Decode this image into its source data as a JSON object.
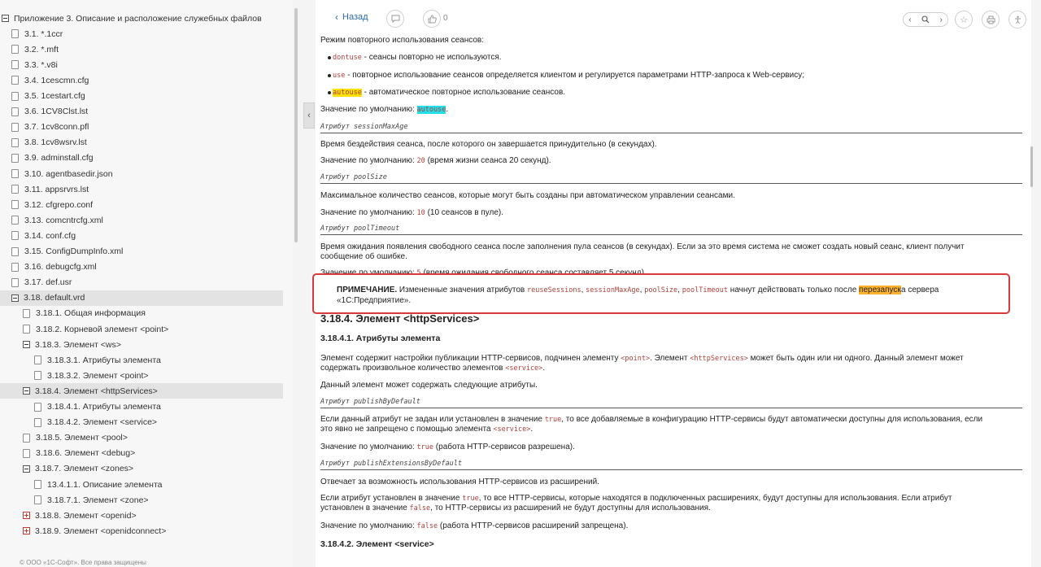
{
  "sidebar": {
    "items": [
      {
        "label": "Приложение 3. Описание и расположение служебных файлов",
        "icon": "toggle-minus",
        "indent": 0,
        "selected": false
      },
      {
        "label": "3.1. *.1ccr",
        "icon": "file",
        "indent": 1
      },
      {
        "label": "3.2. *.mft",
        "icon": "file",
        "indent": 1
      },
      {
        "label": "3.3. *.v8i",
        "icon": "file",
        "indent": 1
      },
      {
        "label": "3.4. 1cescmn.cfg",
        "icon": "file",
        "indent": 1
      },
      {
        "label": "3.5. 1cestart.cfg",
        "icon": "file",
        "indent": 1
      },
      {
        "label": "3.6. 1CV8Clst.lst",
        "icon": "file",
        "indent": 1
      },
      {
        "label": "3.7. 1cv8conn.pfl",
        "icon": "file",
        "indent": 1
      },
      {
        "label": "3.8. 1cv8wsrv.lst",
        "icon": "file",
        "indent": 1
      },
      {
        "label": "3.9. adminstall.cfg",
        "icon": "file",
        "indent": 1
      },
      {
        "label": "3.10. agentbasedir.json",
        "icon": "file",
        "indent": 1
      },
      {
        "label": "3.11. appsrvrs.lst",
        "icon": "file",
        "indent": 1
      },
      {
        "label": "3.12. cfgrepo.conf",
        "icon": "file",
        "indent": 1
      },
      {
        "label": "3.13. comcntrcfg.xml",
        "icon": "file",
        "indent": 1
      },
      {
        "label": "3.14. conf.cfg",
        "icon": "file",
        "indent": 1
      },
      {
        "label": "3.15. ConfigDumpInfo.xml",
        "icon": "file",
        "indent": 1
      },
      {
        "label": "3.16. debugcfg.xml",
        "icon": "file",
        "indent": 1
      },
      {
        "label": "3.17. def.usr",
        "icon": "file",
        "indent": 1
      },
      {
        "label": "3.18. default.vrd",
        "icon": "toggle-minus",
        "indent": 1,
        "selected": true
      },
      {
        "label": "3.18.1. Общая информация",
        "icon": "file",
        "indent": 2
      },
      {
        "label": "3.18.2. Корневой элемент <point>",
        "icon": "file",
        "indent": 2
      },
      {
        "label": "3.18.3. Элемент <ws>",
        "icon": "toggle-minus",
        "indent": 2
      },
      {
        "label": "3.18.3.1. Атрибуты элемента",
        "icon": "file",
        "indent": 3
      },
      {
        "label": "3.18.3.2. Элемент <point>",
        "icon": "file",
        "indent": 3
      },
      {
        "label": "3.18.4. Элемент <httpServices>",
        "icon": "toggle-minus",
        "indent": 2,
        "selected": true
      },
      {
        "label": "3.18.4.1. Атрибуты элемента",
        "icon": "file",
        "indent": 3
      },
      {
        "label": "3.18.4.2. Элемент <service>",
        "icon": "file",
        "indent": 3
      },
      {
        "label": "3.18.5. Элемент <pool>",
        "icon": "file",
        "indent": 2
      },
      {
        "label": "3.18.6. Элемент <debug>",
        "icon": "file",
        "indent": 2
      },
      {
        "label": "3.18.7. Элемент <zones>",
        "icon": "toggle-minus",
        "indent": 2
      },
      {
        "label": "13.4.1.1. Описание элемента",
        "icon": "file",
        "indent": 3
      },
      {
        "label": "3.18.7.1. Элемент <zone>",
        "icon": "file",
        "indent": 3
      },
      {
        "label": "3.18.8. Элемент <openid>",
        "icon": "toggle-plus",
        "indent": 2
      },
      {
        "label": "3.18.9. Элемент <openidconnect>",
        "icon": "toggle-plus",
        "indent": 2
      }
    ],
    "footer": "© ООО «1С-Софт». Все права защищены"
  },
  "toolbar": {
    "back_label": "Назад",
    "like_count": "0",
    "icons": [
      "comment-icon",
      "thumbs-up-icon",
      "search-prev-icon",
      "search-icon",
      "search-next-icon",
      "star-icon",
      "print-icon",
      "accessibility-icon"
    ]
  },
  "content": {
    "reuse_intro": "Режим повторного использования сеансов:",
    "bullet1_code": "dontuse",
    "bullet1_text": " - сеансы повторно не используются.",
    "bullet2_code": "use",
    "bullet2_text": " - повторное использование сеансов определяется клиентом и регулируется параметрами HTTP-запроса к Web-сервису;",
    "bullet3_code": "autouse",
    "bullet3_text": " - автоматическое повторное использование сеансов.",
    "default_prefix": "Значение по умолчанию: ",
    "default1_code": "autouse",
    "attr1": "Атрибут sessionMaxAge",
    "attr1_desc": "Время бездействия сеанса, после которого он завершается принудительно (в секундах).",
    "default2_code": "20",
    "default2_rest": " (время жизни сеанса 20 секунд).",
    "attr2": "Атрибут poolSize",
    "attr2_desc": "Максимальное количество сеансов, которые могут быть созданы при автоматическом управлении сеансами.",
    "default3_code": "10",
    "default3_rest": " (10 сеансов в пуле).",
    "attr3": "Атрибут poolTimeout",
    "attr3_desc_1": "Время ожидания появления свободного сеанса после заполнения пула сеансов (в секундах). Если за это время система не сможет создать новый сеанс, клиент получит",
    "attr3_desc_2": "сообщение об ошибке.",
    "default4_code": "5",
    "default4_rest": " (время ожидания свободного сеанса составляет 5 секунд).",
    "note_label": "ПРИМЕЧАНИЕ.",
    "note_text_1": " Измененные значения атрибутов ",
    "note_code_1": "reuseSessions",
    "note_sep_1": ", ",
    "note_code_2": "sessionMaxAge",
    "note_sep_2": ", ",
    "note_code_3": "poolSize",
    "note_sep_3": ", ",
    "note_code_4": "poolTimeout",
    "note_text_2": " начнут действовать только после ",
    "note_highlight": "перезапуск",
    "note_text_3": "а сервера",
    "note_text_4": "«1С:Предприятие».",
    "h_http": "3.18.4. Элемент <httpServices>",
    "h_http_attrs": "3.18.4.1. Атрибуты элемента",
    "http_desc_1a": "Элемент содержит настройки публикации HTTP-сервисов, подчинен элементу ",
    "http_desc_1_code1": "<point>",
    "http_desc_1b": ". Элемент ",
    "http_desc_1_code2": "<httpServices>",
    "http_desc_1c": " может быть один или ни одного. Данный элемент может",
    "http_desc_2a": "содержать произвольное количество элементов ",
    "http_desc_2_code": "<service>",
    "http_desc_2b": ".",
    "http_desc_3": "Данный элемент может содержать следующие атрибуты.",
    "attr4": "Атрибут publishByDefault",
    "attr4_desc_1a": "Если данный атрибут не задан или установлен в значение ",
    "attr4_desc_1_code": "true",
    "attr4_desc_1b": ", то все добавляемые в конфигурацию HTTP-сервисы будут автоматически доступны для использования, если",
    "attr4_desc_2a": "это явно не запрещено с помощью элемента ",
    "attr4_desc_2_code": "<service>",
    "attr4_desc_2b": ".",
    "default5_code": "true",
    "default5_rest": " (работа HTTP-сервисов разрешена).",
    "attr5": "Атрибут publishExtensionsByDefault",
    "attr5_desc": "Отвечает за возможность использования HTTP-сервисов из расширений.",
    "attr5_desc_1a": "Если атрибут установлен в значение ",
    "attr5_desc_1_code": "true",
    "attr5_desc_1b": ", то все HTTP-сервисы, которые находятся в подключенных расширениях, будут доступны для использования. Если атрибут",
    "attr5_desc_2a": "установлен в значение ",
    "attr5_desc_2_code": "false",
    "attr5_desc_2b": ", то HTTP-сервисы из расширений не будут доступны для использования.",
    "default6_code": "false",
    "default6_rest": " (работа HTTP-сервисов расширений запрещена).",
    "h_service": "3.18.4.2. Элемент <service>"
  },
  "colors": {
    "highlight_cyan": "#22e0ea",
    "highlight_yellow": "#ffe200",
    "highlight_orange": "#ffb32c",
    "note_border": "#d63a3a",
    "code_text": "#b0403a",
    "link": "#2d6aa8"
  }
}
